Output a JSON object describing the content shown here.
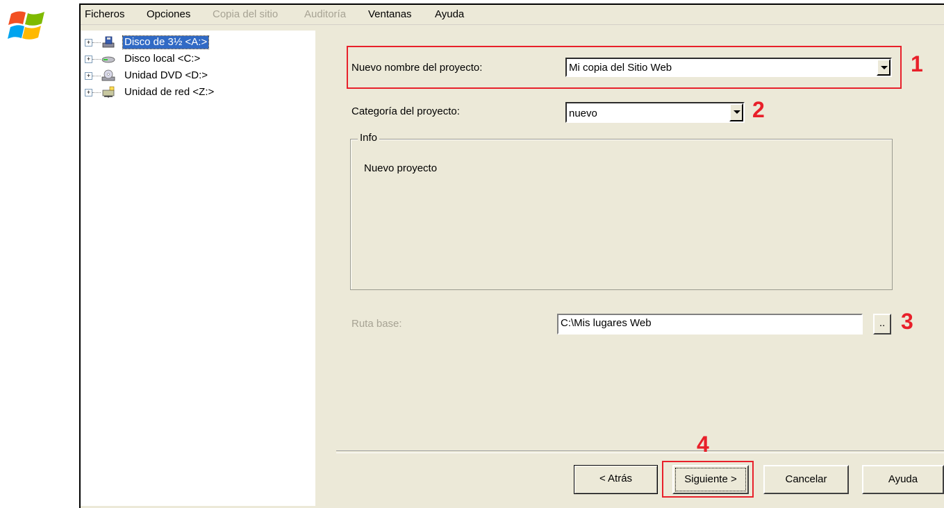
{
  "menu": [
    {
      "label": "Ficheros",
      "enabled": true
    },
    {
      "label": "Opciones",
      "enabled": true
    },
    {
      "label": "Copia del sitio",
      "enabled": false
    },
    {
      "label": "Auditoría",
      "enabled": false
    },
    {
      "label": "Ventanas",
      "enabled": true
    },
    {
      "label": "Ayuda",
      "enabled": true
    }
  ],
  "tree": [
    {
      "label": "Disco de 3½ <A:>",
      "icon": "floppy-drive-icon",
      "selected": true
    },
    {
      "label": "Disco local <C:>",
      "icon": "hard-disk-icon",
      "selected": false
    },
    {
      "label": "Unidad DVD <D:>",
      "icon": "dvd-drive-icon",
      "selected": false
    },
    {
      "label": "Unidad de red <Z:>",
      "icon": "network-drive-icon",
      "selected": false
    }
  ],
  "form": {
    "project_name_label": "Nuevo nombre del proyecto:",
    "project_name_value": "Mi copia del Sitio Web",
    "project_category_label": "Categoría del proyecto:",
    "project_category_value": "nuevo",
    "info_legend": "Info",
    "info_text": "Nuevo proyecto",
    "base_path_label": "Ruta base:",
    "base_path_value": "C:\\Mis lugares Web",
    "browse_label": ".."
  },
  "buttons": {
    "back": "< Atrás",
    "next": "Siguiente >",
    "cancel": "Cancelar",
    "help": "Ayuda"
  },
  "annotations": [
    "1",
    "2",
    "3",
    "4"
  ],
  "colors": {
    "annotation": "#e8202a",
    "selection": "#316ac5",
    "window_bg": "#ece9d8"
  }
}
